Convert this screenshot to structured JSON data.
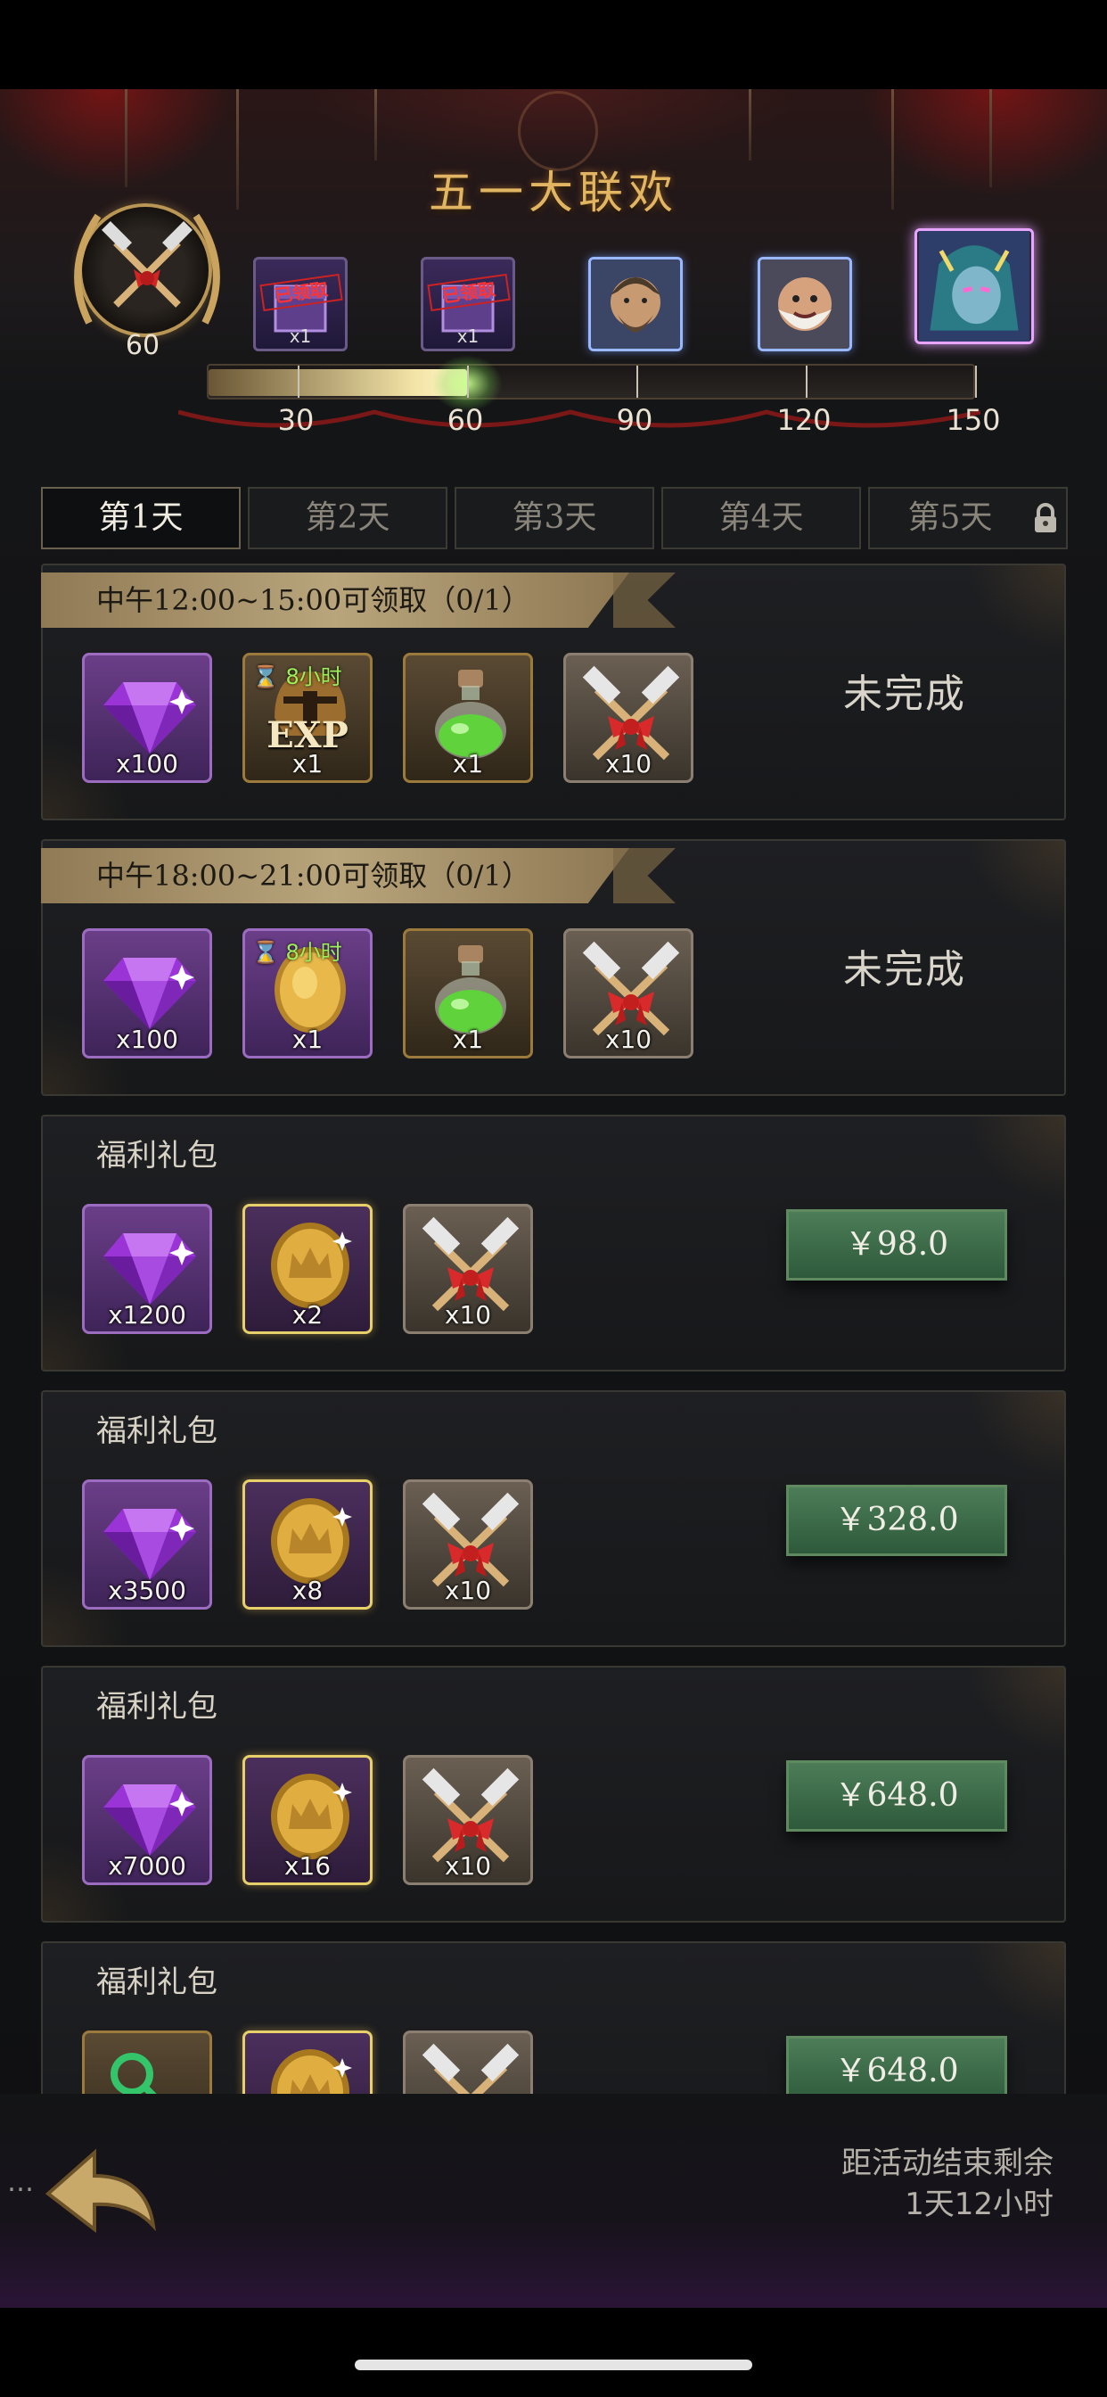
{
  "event": {
    "title": "五一大联欢"
  },
  "progress": {
    "current": 60,
    "max": 150,
    "marks": [
      "30",
      "60",
      "90",
      "120",
      "150"
    ],
    "milestones": [
      {
        "state": "claimed",
        "stamp": "已领取",
        "count": "x1",
        "icon": "purple-box-icon"
      },
      {
        "state": "claimed",
        "stamp": "已领取",
        "count": "x1",
        "icon": "purple-box-icon"
      },
      {
        "state": "locked",
        "icon": "hero-warrior-portrait"
      },
      {
        "state": "locked",
        "icon": "hero-dwarf-portrait"
      },
      {
        "state": "locked",
        "icon": "hero-sorceress-portrait"
      }
    ],
    "badge_value": "60"
  },
  "tabs": [
    {
      "label": "第1天",
      "active": true
    },
    {
      "label": "第2天",
      "active": false
    },
    {
      "label": "第3天",
      "active": false
    },
    {
      "label": "第4天",
      "active": false
    },
    {
      "label": "第5天",
      "active": false,
      "locked": true
    }
  ],
  "tasks": [
    {
      "banner": "中午12:00~15:00可领取（0/1）",
      "status": "未完成",
      "items": [
        {
          "icon": "gem-icon",
          "frame": "purple",
          "qty": "x100"
        },
        {
          "icon": "exp-helmet-icon",
          "frame": "bronze",
          "qty": "x1",
          "timer": "8小时",
          "label": "EXP"
        },
        {
          "icon": "green-potion-icon",
          "frame": "bronze",
          "qty": "x1"
        },
        {
          "icon": "crossed-hammers-icon",
          "frame": "gray",
          "qty": "x10"
        }
      ]
    },
    {
      "banner": "中午18:00~21:00可领取（0/1）",
      "status": "未完成",
      "items": [
        {
          "icon": "gem-icon",
          "frame": "purple",
          "qty": "x100"
        },
        {
          "icon": "gold-coin-icon",
          "frame": "purple",
          "qty": "x1",
          "timer": "8小时"
        },
        {
          "icon": "green-potion-icon",
          "frame": "bronze",
          "qty": "x1"
        },
        {
          "icon": "crossed-hammers-icon",
          "frame": "gray",
          "qty": "x10"
        }
      ]
    }
  ],
  "packs": [
    {
      "title": "福利礼包",
      "price": "￥98.0",
      "items": [
        {
          "icon": "gem-icon",
          "frame": "purple",
          "qty": "x1200"
        },
        {
          "icon": "crown-coin-icon",
          "frame": "gold",
          "qty": "x2"
        },
        {
          "icon": "crossed-hammers-icon",
          "frame": "gray",
          "qty": "x10"
        }
      ]
    },
    {
      "title": "福利礼包",
      "price": "￥328.0",
      "items": [
        {
          "icon": "gem-icon",
          "frame": "purple",
          "qty": "x3500"
        },
        {
          "icon": "crown-coin-icon",
          "frame": "gold",
          "qty": "x8"
        },
        {
          "icon": "crossed-hammers-icon",
          "frame": "gray",
          "qty": "x10"
        }
      ]
    },
    {
      "title": "福利礼包",
      "price": "￥648.0",
      "items": [
        {
          "icon": "gem-icon",
          "frame": "purple",
          "qty": "x7000"
        },
        {
          "icon": "crown-coin-icon",
          "frame": "gold",
          "qty": "x16"
        },
        {
          "icon": "crossed-hammers-icon",
          "frame": "gray",
          "qty": "x10"
        }
      ]
    },
    {
      "title": "福利礼包",
      "price": "￥648.0",
      "items": [
        {
          "icon": "green-key-icon",
          "frame": "bronze",
          "qty": ""
        },
        {
          "icon": "crown-coin-icon",
          "frame": "gold",
          "qty": ""
        },
        {
          "icon": "crossed-hammers-icon",
          "frame": "gray",
          "qty": ""
        }
      ]
    }
  ],
  "footer": {
    "countdown_label": "距活动结束剩余",
    "countdown_value": "1天12小时",
    "more": "…"
  },
  "colors": {
    "title_gold": "#e2b563",
    "price_green": "#3e6c49",
    "claimed_red": "#ff3333",
    "timer_green": "#9cf05a"
  }
}
